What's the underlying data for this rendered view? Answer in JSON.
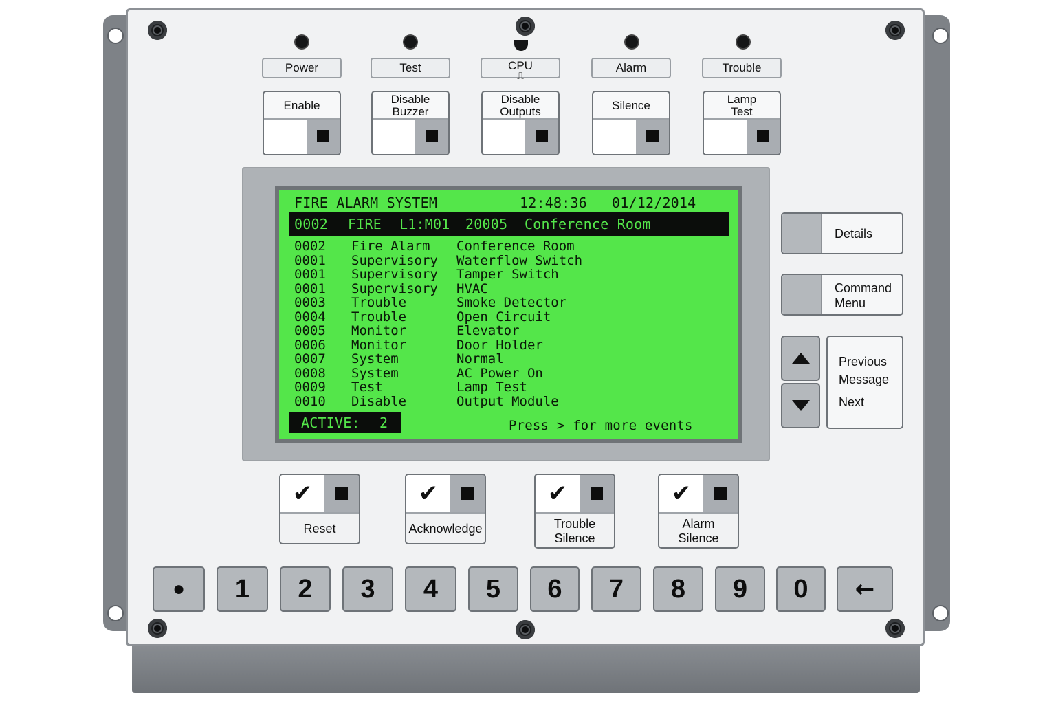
{
  "status_leds": [
    {
      "label": "Power"
    },
    {
      "label": "Test"
    },
    {
      "label": "CPU",
      "sub": "⎍"
    },
    {
      "label": "Alarm"
    },
    {
      "label": "Trouble"
    }
  ],
  "function_keys": [
    {
      "label": "Enable"
    },
    {
      "label": "Disable Buzzer"
    },
    {
      "label": "Disable Outputs"
    },
    {
      "label": "Silence"
    },
    {
      "label": "Lamp Test"
    }
  ],
  "display": {
    "title": "FIRE ALARM SYSTEM",
    "time": "12:48:36",
    "date": "01/12/2014",
    "highlight": {
      "count": "0002",
      "type": "FIRE",
      "address": "L1:M01",
      "zone": "20005",
      "description": "Conference Room"
    },
    "events": [
      {
        "count": "0002",
        "type": "Fire Alarm",
        "description": "Conference Room"
      },
      {
        "count": "0001",
        "type": "Supervisory",
        "description": "Waterflow Switch"
      },
      {
        "count": "0001",
        "type": "Supervisory",
        "description": "Tamper Switch"
      },
      {
        "count": "0001",
        "type": "Supervisory",
        "description": "HVAC"
      },
      {
        "count": "0003",
        "type": "Trouble",
        "description": "Smoke Detector"
      },
      {
        "count": "0004",
        "type": "Trouble",
        "description": "Open Circuit"
      },
      {
        "count": "0005",
        "type": "Monitor",
        "description": "Elevator"
      },
      {
        "count": "0006",
        "type": "Monitor",
        "description": "Door Holder"
      },
      {
        "count": "0007",
        "type": "System",
        "description": "Normal"
      },
      {
        "count": "0008",
        "type": "System",
        "description": "AC Power On"
      },
      {
        "count": "0009",
        "type": "Test",
        "description": "Lamp Test"
      },
      {
        "count": "0010",
        "type": "Disable",
        "description": "Output Module"
      }
    ],
    "active_label": "ACTIVE:",
    "active_count": "2",
    "footer": "Press > for more events"
  },
  "side_nav": {
    "details": "Details",
    "command_menu_line1": "Command",
    "command_menu_line2": "Menu",
    "previous_line1": "Previous",
    "message": "Message",
    "next": "Next"
  },
  "action_keys": [
    {
      "line1": "Reset",
      "line2": ""
    },
    {
      "line1": "Acknowledge",
      "line2": ""
    },
    {
      "line1": "Trouble",
      "line2": "Silence"
    },
    {
      "line1": "Alarm",
      "line2": "Silence"
    }
  ],
  "check_glyph": "✔",
  "keypad": [
    "●",
    "1",
    "2",
    "3",
    "4",
    "5",
    "6",
    "7",
    "8",
    "9",
    "0",
    "←"
  ],
  "colors": {
    "lcd_background": "#54e64a",
    "lcd_text": "#0a1a08",
    "panel": "#f1f2f3",
    "housing": "#7e8287",
    "key_gray": "#b4b8bc"
  }
}
